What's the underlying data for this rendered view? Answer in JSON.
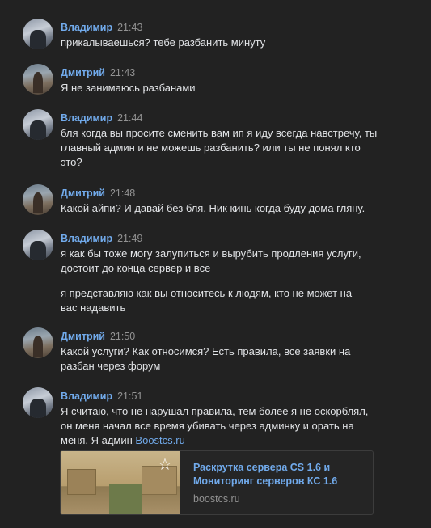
{
  "messages": [
    {
      "author": "Владимир",
      "time": "21:43",
      "avatar": "vladimir",
      "paragraphs": [
        "прикалываешься? тебе разбанить минуту"
      ]
    },
    {
      "author": "Дмитрий",
      "time": "21:43",
      "avatar": "dmitry",
      "paragraphs": [
        "Я не занимаюсь разбанами"
      ]
    },
    {
      "author": "Владимир",
      "time": "21:44",
      "avatar": "vladimir",
      "paragraphs": [
        "бля когда вы просите сменить вам ип я иду всегда навстречу, ты главный админ и не можешь разбанить? или ты не понял кто это?"
      ]
    },
    {
      "author": "Дмитрий",
      "time": "21:48",
      "avatar": "dmitry",
      "paragraphs": [
        "Какой айпи? И давай без бля. Ник кинь когда буду дома гляну."
      ]
    },
    {
      "author": "Владимир",
      "time": "21:49",
      "avatar": "vladimir",
      "paragraphs": [
        "я как бы тоже могу залупиться и вырубить продления услуги, достоит до конца сервер и все",
        "я представляю как вы относитесь к людям, кто не может на вас надавить"
      ]
    },
    {
      "author": "Дмитрий",
      "time": "21:50",
      "avatar": "dmitry",
      "paragraphs": [
        "Какой услуги? Как относимся? Есть правила, все заявки на разбан через форум"
      ]
    },
    {
      "author": "Владимир",
      "time": "21:51",
      "avatar": "vladimir",
      "paragraphs": [
        "Я считаю, что не нарушал правила, тем более я не оскорблял, он меня начал все время убивать через админку и орать на меня. Я админ "
      ],
      "link_text": "Boostcs.ru"
    }
  ],
  "link_card": {
    "title": "Раскрутка сервера CS 1.6 и Мониторинг серверов КС 1.6",
    "domain": "boostcs.ru",
    "icon": "star-icon"
  },
  "colors": {
    "background": "#222222",
    "author": "#71aaeb",
    "time": "#939393",
    "text": "#e1e3e6"
  }
}
